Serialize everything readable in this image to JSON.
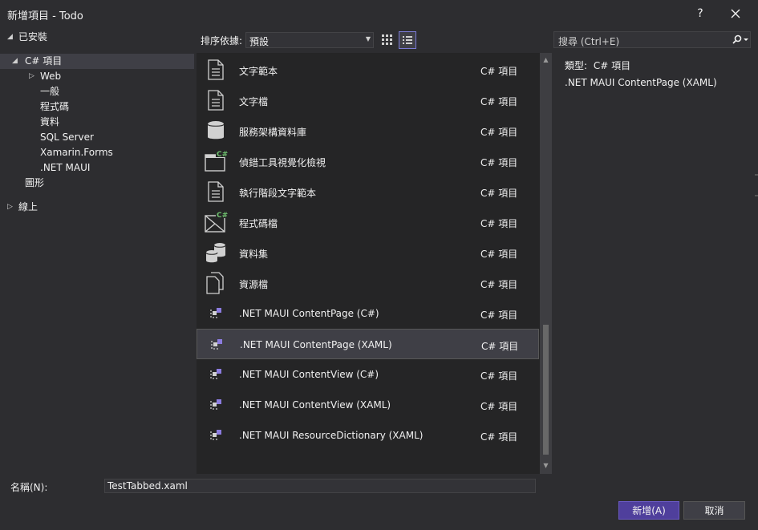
{
  "window": {
    "title": "新增項目 - Todo",
    "help_label": "?",
    "close_label": "✕"
  },
  "tree": {
    "installed": "已安裝",
    "csharp_items": "C# 項目",
    "web": "Web",
    "general": "一般",
    "code": "程式碼",
    "data": "資料",
    "sql_server": "SQL Server",
    "xamarin_forms": "Xamarin.Forms",
    "net_maui": ".NET MAUI",
    "graphics": "圖形",
    "online": "線上"
  },
  "toolbar": {
    "sort_label": "排序依據:",
    "sort_value": "預設"
  },
  "search": {
    "placeholder": "搜尋 (Ctrl+E)"
  },
  "templates": [
    {
      "name": "文字範本",
      "category": "C# 項目",
      "icon": "text-file-icon"
    },
    {
      "name": "文字檔",
      "category": "C# 項目",
      "icon": "text-file-icon"
    },
    {
      "name": "服務架構資料庫",
      "category": "C# 項目",
      "icon": "database-icon"
    },
    {
      "name": "偵錯工具視覺化檢視",
      "category": "C# 項目",
      "icon": "window-csharp-icon"
    },
    {
      "name": "執行階段文字範本",
      "category": "C# 項目",
      "icon": "text-file-icon"
    },
    {
      "name": "程式碼檔",
      "category": "C# 項目",
      "icon": "code-file-csharp-icon"
    },
    {
      "name": "資料集",
      "category": "C# 項目",
      "icon": "dataset-icon"
    },
    {
      "name": "資源檔",
      "category": "C# 項目",
      "icon": "resource-file-icon"
    },
    {
      "name": ".NET MAUI ContentPage (C#)",
      "category": "C# 項目",
      "icon": "maui-icon"
    },
    {
      "name": ".NET MAUI ContentPage (XAML)",
      "category": "C# 項目",
      "icon": "maui-icon",
      "selected": true
    },
    {
      "name": ".NET MAUI ContentView (C#)",
      "category": "C# 項目",
      "icon": "maui-icon"
    },
    {
      "name": ".NET MAUI ContentView (XAML)",
      "category": "C# 項目",
      "icon": "maui-icon"
    },
    {
      "name": ".NET MAUI ResourceDictionary (XAML)",
      "category": "C# 項目",
      "icon": "maui-icon"
    }
  ],
  "details": {
    "type_label": "類型:",
    "type_value": "C# 項目",
    "description": ".NET MAUI ContentPage (XAML)"
  },
  "footer": {
    "name_label": "名稱(N):",
    "name_value": "TestTabbed.xaml",
    "add_button": "新增(A)",
    "cancel_button": "取消"
  },
  "colors": {
    "accent": "#4f3f9c",
    "selection": "#3f3f46",
    "background": "#2d2d30",
    "list_background": "#252526"
  }
}
